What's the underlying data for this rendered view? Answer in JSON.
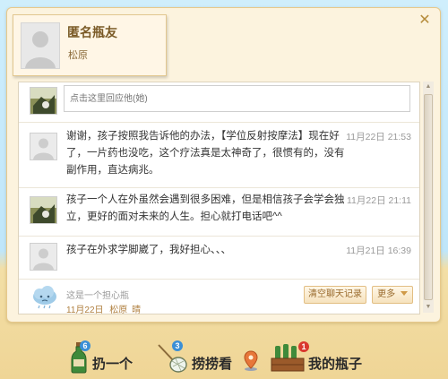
{
  "dialog": {
    "profile": {
      "nickname": "匿名瓶友",
      "location": "松原"
    },
    "close_glyph": "✕"
  },
  "reply": {
    "placeholder": "点击这里回应他(她)"
  },
  "messages": [
    {
      "text": "谢谢，孩子按照我告诉他的办法，【学位反射按摩法】现在好了，一片药也没吃，这个疗法真是太神奇了，很惯有的，没有副作用，直达病兆。",
      "time": "11月22日 21:53"
    },
    {
      "text": "孩子一个人在外虽然会遇到很多困难，但是相信孩子会学会独立，更好的面对未来的人生。担心就打电话吧^^",
      "time": "11月22日 21:11"
    },
    {
      "text": "孩子在外求学脚崴了，我好担心、、、",
      "time": "11月21日 16:39"
    }
  ],
  "footer": {
    "mood": "这是一个担心瓶",
    "date": "11月22日",
    "place": "松原",
    "weather": "晴",
    "clear_button": "清空聊天记录",
    "more_button": "更多"
  },
  "toolbar": {
    "throw": {
      "label": "扔一个",
      "count": "6"
    },
    "fish": {
      "label": "捞捞看",
      "count": "3"
    },
    "mine": {
      "label": "我的瓶子",
      "count": "1"
    }
  },
  "colors": {
    "accent": "#b68d3d",
    "badge_blue": "#3a8fd6",
    "badge_red": "#d9382e"
  }
}
